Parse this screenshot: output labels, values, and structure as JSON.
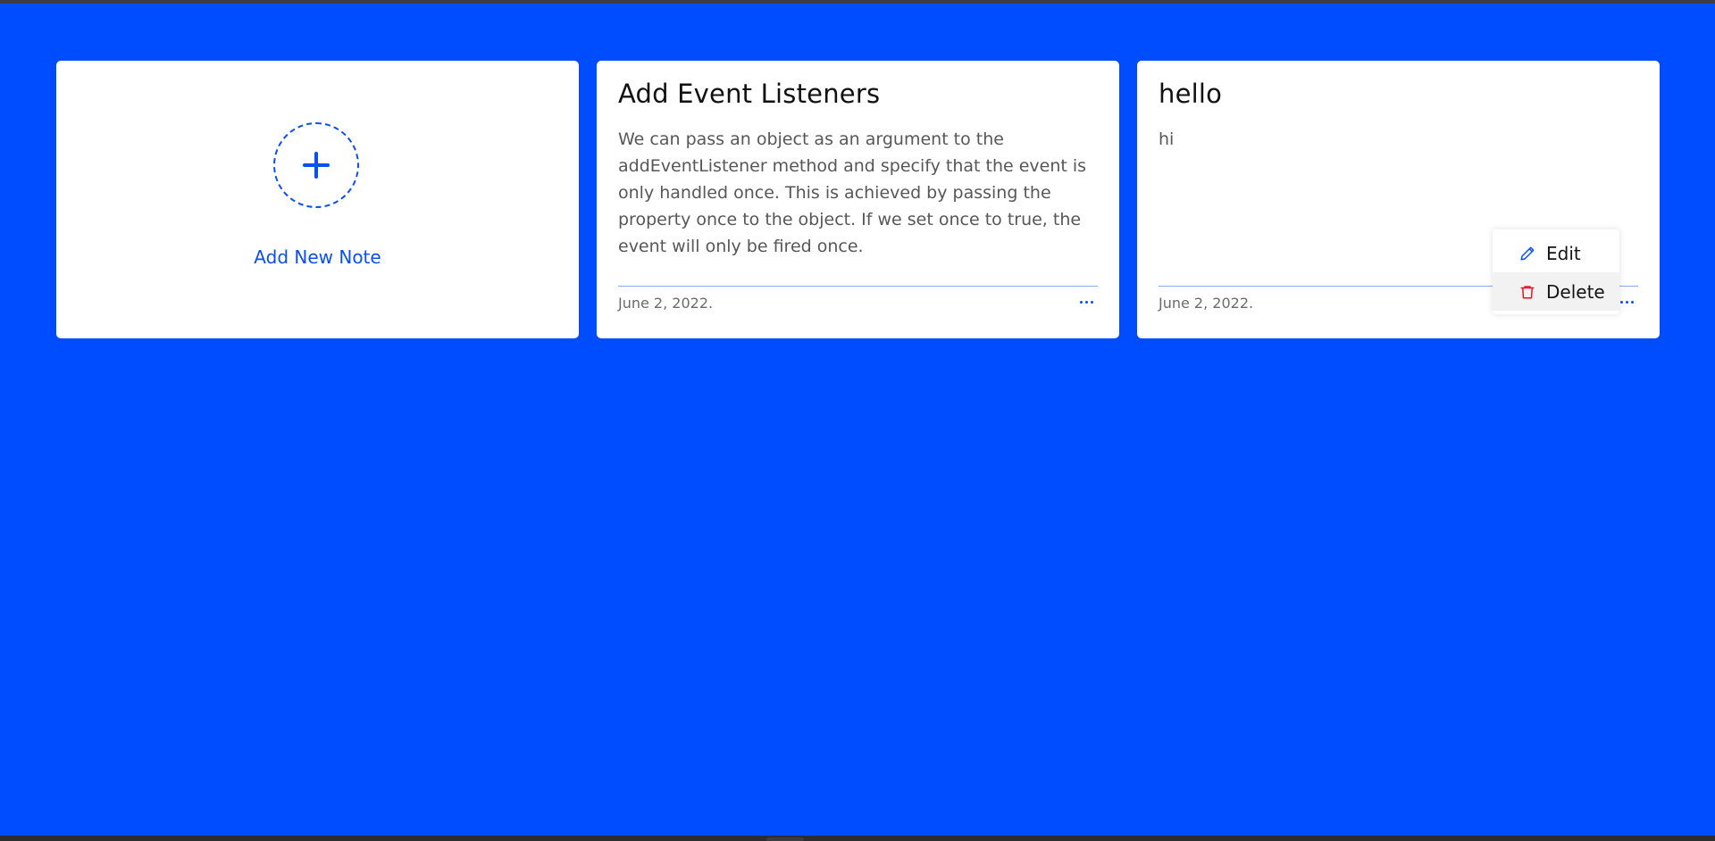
{
  "add_card": {
    "label": "Add New Note",
    "icon": "plus-icon"
  },
  "notes": [
    {
      "title": "Add Event Listeners",
      "description": "We can pass an object as an argument to the addEventListener method and specify that the event is only handled once. This is achieved by passing the property once to the object. If we set once to true, the event will only be fired once.",
      "date": "June 2, 2022.",
      "more_icon": "more-horizontal-icon"
    },
    {
      "title": "hello",
      "description": "hi",
      "date": "June 2, 2022.",
      "more_icon": "more-horizontal-icon"
    }
  ],
  "context_menu": {
    "items": [
      {
        "label": "Edit",
        "icon": "pencil-icon",
        "color": "#0a4ff0"
      },
      {
        "label": "Delete",
        "icon": "trash-icon",
        "color": "#e0162b"
      }
    ]
  },
  "colors": {
    "background": "#004dff",
    "accent": "#0a4ff0",
    "danger": "#e0162b",
    "card": "#ffffff"
  }
}
